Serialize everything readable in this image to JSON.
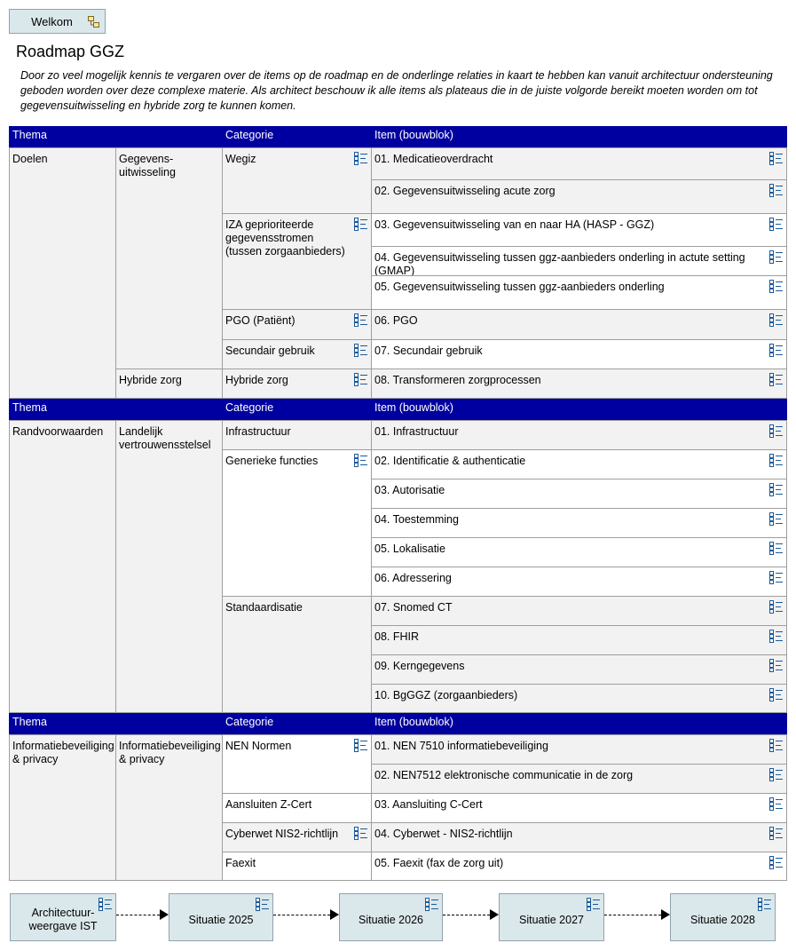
{
  "welkom": {
    "label": "Welkom"
  },
  "title": "Roadmap GGZ",
  "intro": "Door zo veel mogelijk kennis te vergaren over de items op de roadmap en de onderlinge relaties in kaart te hebben kan vanuit architectuur ondersteuning geboden worden over deze complexe materie. Als architect beschouw ik alle items als plateaus die in de juiste volgorde bereikt moeten worden om tot gegevensuitwisseling en hybride zorg te kunnen komen.",
  "headers": {
    "thema": "Thema",
    "categorie": "Categorie",
    "item": "Item (bouwblok)"
  },
  "sections": [
    {
      "thema": "Doelen",
      "subthemas": [
        "Gegevens-\nuitwisseling",
        "Hybride zorg"
      ],
      "categories": [
        "Wegiz",
        "IZA geprioriteerde gegevensstromen (tussen zorgaanbieders)",
        "PGO (Patiënt)",
        "Secundair gebruik",
        "Hybride zorg"
      ],
      "items": [
        "01. Medicatieoverdracht",
        "02. Gegevensuitwisseling acute zorg",
        "03. Gegevensuitwisseling van en naar HA (HASP - GGZ)",
        "04. Gegevensuitwisseling tussen ggz-aanbieders onderling in actute setting (GMAP)",
        "05. Gegevensuitwisseling tussen ggz-aanbieders onderling",
        "06. PGO",
        "07. Secundair gebruik",
        "08. Transformeren zorgprocessen"
      ]
    },
    {
      "thema": "Randvoorwaarden",
      "subthemas": [
        "Landelijk vertrouwensstelsel"
      ],
      "categories": [
        "Infrastructuur",
        "Generieke functies",
        "Standaardisatie"
      ],
      "items": [
        "01. Infrastructuur",
        "02. Identificatie & authenticatie",
        "03. Autorisatie",
        "04. Toestemming",
        "05. Lokalisatie",
        "06. Adressering",
        "07. Snomed CT",
        "08. FHIR",
        "09. Kerngegevens",
        "10. BgGGZ (zorgaanbieders)"
      ]
    },
    {
      "thema": "Informatiebeveiliging & privacy",
      "subthemas": [
        "Informatiebeveiliging & privacy"
      ],
      "categories": [
        "NEN Normen",
        "Aansluiten Z-Cert",
        "Cyberwet NIS2-richtlijn",
        "Faexit"
      ],
      "items": [
        "01. NEN 7510 informatiebeveiliging",
        "02. NEN7512 elektronische communicatie in de zorg",
        "03. Aansluiting C-Cert",
        "04. Cyberwet - NIS2-richtlijn",
        "05. Faexit (fax de zorg uit)"
      ]
    }
  ],
  "timeline": [
    "Architectuur-\nweergave IST",
    "Situatie 2025",
    "Situatie 2026",
    "Situatie 2027",
    "Situatie 2028"
  ],
  "colors": {
    "header": "#0000a0",
    "box": "#dbe8eb",
    "grey_cell": "#f2f2f2"
  },
  "icons": {
    "list": "list-view-icon",
    "welkom": "diagram-icon"
  }
}
